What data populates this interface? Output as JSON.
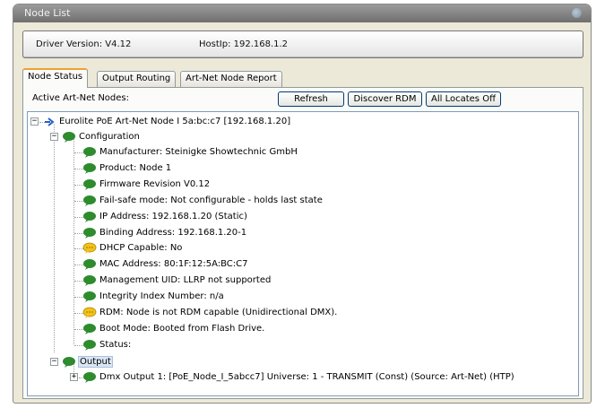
{
  "window": {
    "title": "Node List"
  },
  "info": {
    "driver_version": "Driver Version: V4.12",
    "host_ip": "HostIp: 192.168.1.2"
  },
  "tabs": [
    {
      "label": "Node Status",
      "active": true
    },
    {
      "label": "Output Routing",
      "active": false
    },
    {
      "label": "Art-Net Node Report",
      "active": false
    }
  ],
  "panel": {
    "active_label": "Active Art-Net Nodes:",
    "buttons": {
      "refresh": "Refresh",
      "discover_rdm": "Discover RDM",
      "all_locates_off": "All Locates Off"
    }
  },
  "tree": {
    "root": "Eurolite PoE Art-Net Node I 5a:bc:c7 [192.168.1.20]",
    "configuration": {
      "label": "Configuration",
      "items": [
        {
          "label": "Manufacturer: Steinigke Showtechnic GmbH",
          "icon": "green-bubble"
        },
        {
          "label": "Product: Node 1",
          "icon": "green-bubble"
        },
        {
          "label": "Firmware Revision V0.12",
          "icon": "green-bubble"
        },
        {
          "label": "Fail-safe mode: Not configurable - holds last state",
          "icon": "green-bubble"
        },
        {
          "label": "IP Address: 192.168.1.20 (Static)",
          "icon": "green-bubble"
        },
        {
          "label": "Binding Address: 192.168.1.20-1",
          "icon": "green-bubble"
        },
        {
          "label": "DHCP Capable: No",
          "icon": "yellow-bubble"
        },
        {
          "label": "MAC Address: 80:1F:12:5A:BC:C7",
          "icon": "green-bubble"
        },
        {
          "label": "Management UID: LLRP not supported",
          "icon": "green-bubble"
        },
        {
          "label": "Integrity Index Number: n/a",
          "icon": "green-bubble"
        },
        {
          "label": "RDM: Node is not RDM capable (Unidirectional DMX).",
          "icon": "yellow-bubble"
        },
        {
          "label": "Boot Mode: Booted from Flash Drive.",
          "icon": "green-bubble"
        },
        {
          "label": "Status:",
          "icon": "green-bubble"
        }
      ]
    },
    "output": {
      "label": "Output",
      "items": [
        {
          "label": "Dmx Output 1: [PoE_Node_I_5abcc7] Universe: 1  - TRANSMIT   (Const) (Source: Art-Net) (HTP)",
          "icon": "green-bubble"
        }
      ]
    }
  },
  "colors": {
    "green_bubble": "#2e8b2e",
    "yellow_bubble": "#f2c21a",
    "tab_highlight": "#f0a030"
  }
}
